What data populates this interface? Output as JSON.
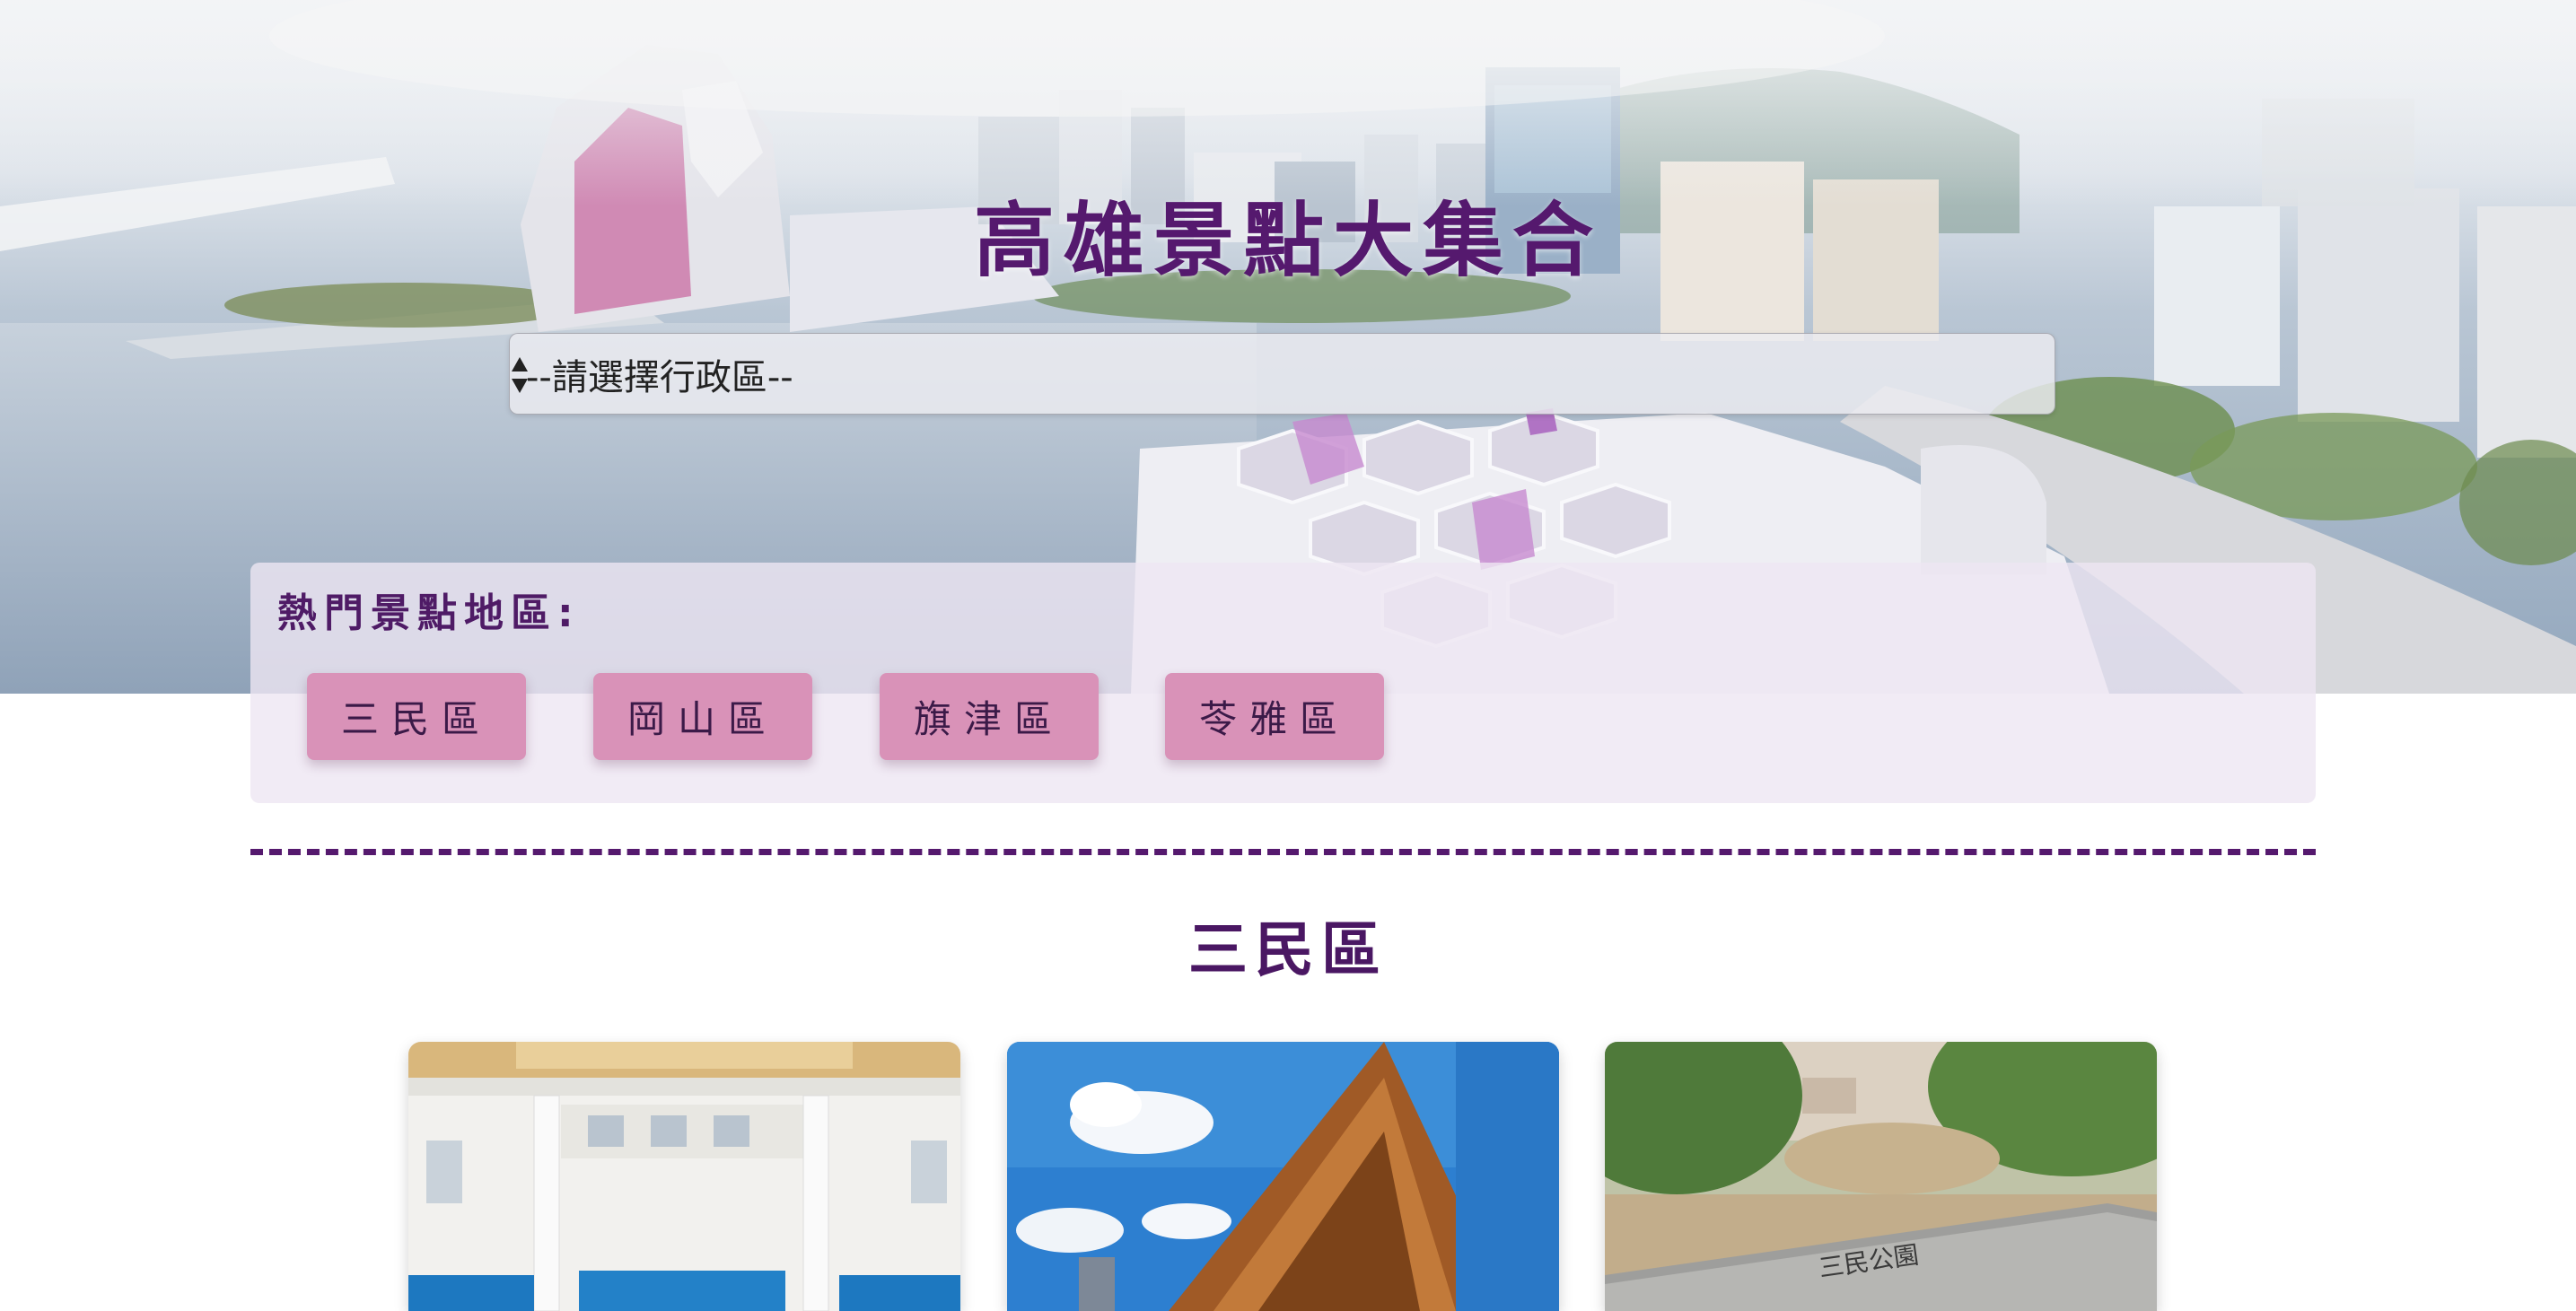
{
  "header": {
    "title": "高雄景點大集合"
  },
  "district_select": {
    "selected": "--請選擇行政區--"
  },
  "popular": {
    "heading": "熱門景點地區:",
    "districts": [
      "三民區",
      "岡山區",
      "旗津區",
      "苓雅區"
    ]
  },
  "section": {
    "title": "三民區"
  },
  "cards": [
    {
      "image": "station-hall-interior-photo"
    },
    {
      "image": "wooden-pavilion-blue-sky-photo"
    },
    {
      "image": "park-stone-sign-photo",
      "sign_text": "三民公園"
    }
  ],
  "colors": {
    "title": "#55196e",
    "button": "#d992b8",
    "panel": "#eee6f3",
    "divider": "#55196e"
  }
}
